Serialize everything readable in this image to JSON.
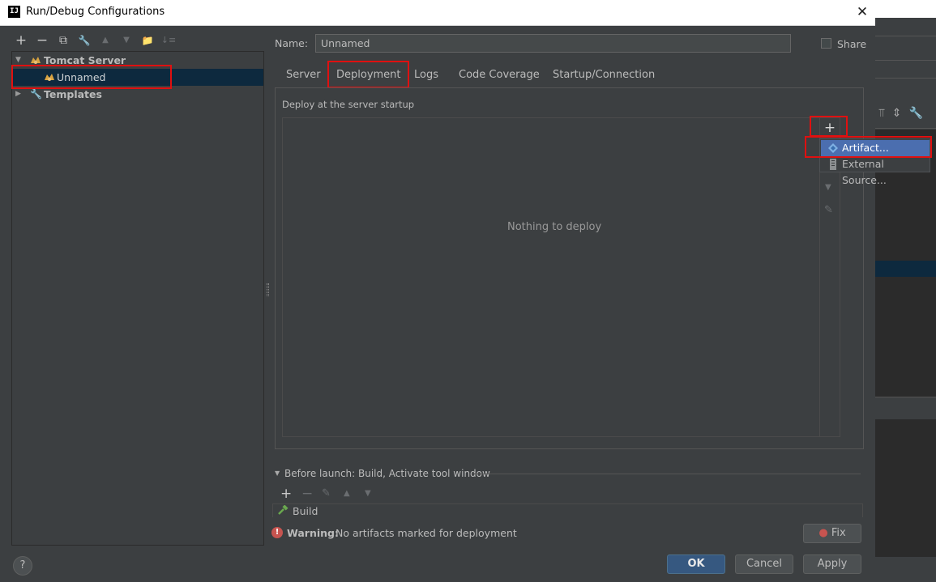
{
  "window": {
    "title": "Run/Debug Configurations",
    "logo_text": "IJ",
    "close_glyph": "✕"
  },
  "left_toolbar": {
    "add": "+",
    "remove": "−",
    "copy": "⧉",
    "edit": "🔧",
    "up": "▲",
    "down": "▼",
    "folder": "📁",
    "sort": "↓≡"
  },
  "tree": {
    "tomcat_label": "Tomcat Server",
    "unnamed_label": "Unnamed",
    "templates_label": "Templates"
  },
  "form": {
    "name_label": "Name:",
    "name_value": "Unnamed",
    "share_label": "Share"
  },
  "tabs": [
    "Server",
    "Deployment",
    "Logs",
    "Code Coverage",
    "Startup/Connection"
  ],
  "deployment": {
    "section_label": "Deploy at the server startup",
    "empty_text": "Nothing to deploy",
    "add_glyph": "+",
    "down_glyph": "▼",
    "edit_glyph": "✎"
  },
  "popup": {
    "items": [
      "Artifact...",
      "External Source..."
    ]
  },
  "before_launch": {
    "label": "Before launch: Build, Activate tool window",
    "toggle": "▼",
    "add": "+",
    "remove": "−",
    "edit": "✎",
    "up": "▲",
    "down": "▼",
    "build_label": "Build"
  },
  "warning": {
    "prefix": "Warning:",
    "text": "No artifacts marked for deployment",
    "icon": "!"
  },
  "buttons": {
    "fix": "Fix",
    "ok": "OK",
    "cancel": "Cancel",
    "apply": "Apply",
    "help": "?"
  },
  "colors": {
    "accent": "#4b6eaf",
    "highlight_red": "#e01010",
    "selection": "#0d293e",
    "panel_bg": "#3c3f41"
  }
}
